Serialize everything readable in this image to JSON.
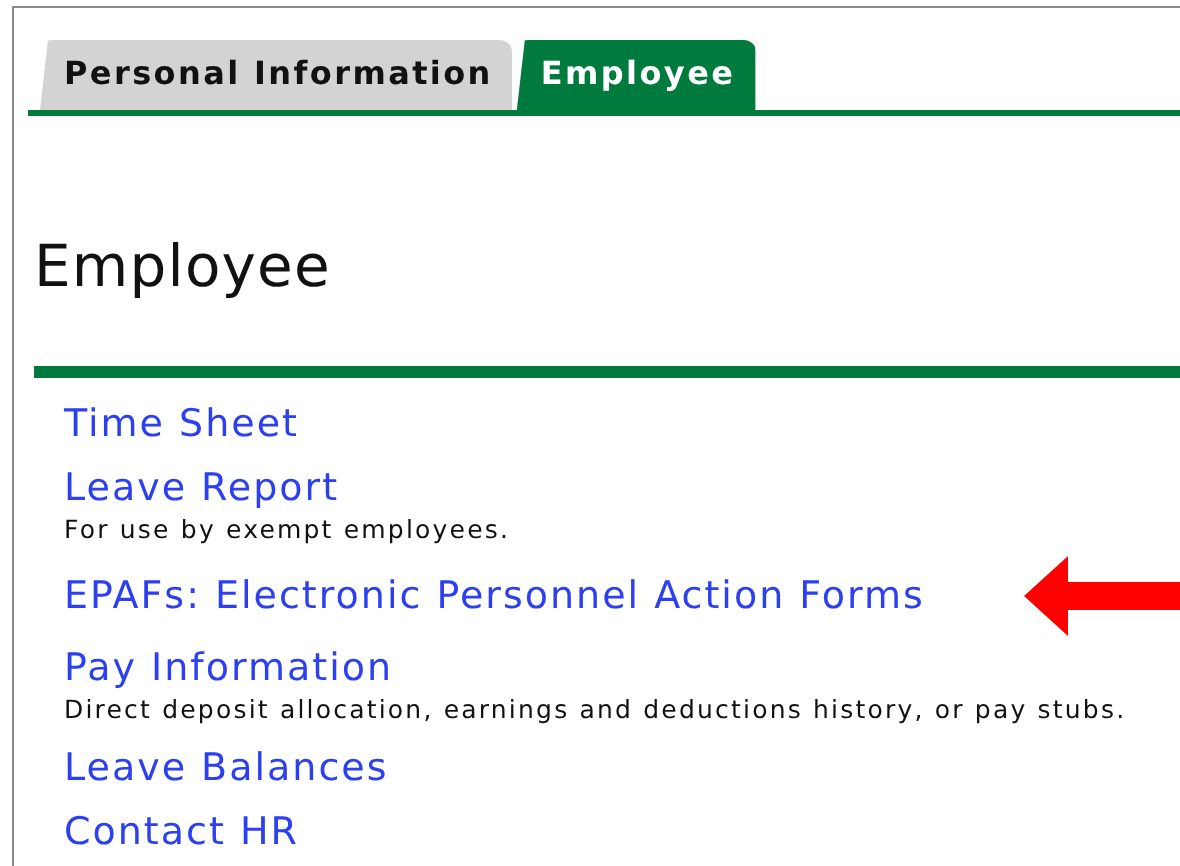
{
  "tabs": [
    {
      "label": "Personal Information",
      "selected": false
    },
    {
      "label": "Employee",
      "selected": true
    }
  ],
  "heading": "Employee",
  "links": [
    {
      "label": "Time Sheet",
      "highlighted": false
    },
    {
      "label": "Leave Report",
      "description": "For use by exempt employees.",
      "highlighted": false
    },
    {
      "label": "EPAFs: Electronic Personnel Action Forms",
      "highlighted": true
    },
    {
      "label": "Pay Information",
      "description": "Direct deposit allocation, earnings and deductions history, or pay stubs.",
      "highlighted": false
    },
    {
      "label": "Leave Balances",
      "highlighted": false
    },
    {
      "label": "Contact HR",
      "highlighted": false
    }
  ]
}
